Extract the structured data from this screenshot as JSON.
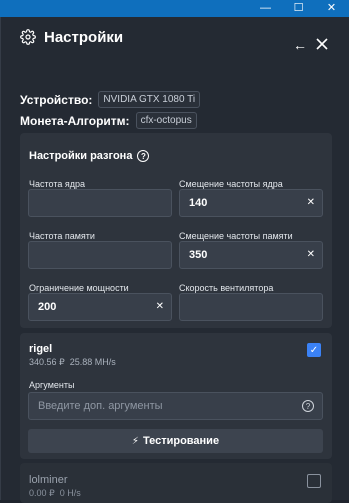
{
  "window": {
    "minimize_glyph": "—",
    "maximize_glyph": "☐",
    "close_glyph": "✕"
  },
  "header": {
    "title": "Настройки",
    "back_glyph": "←",
    "icon": "gear-icon"
  },
  "device": {
    "label": "Устройство:",
    "value": "NVIDIA GTX 1080 Ti"
  },
  "coin_algo": {
    "label": "Монета-Алгоритм:",
    "value": "cfx-octopus"
  },
  "overclock": {
    "title": "Настройки разгона",
    "help_glyph": "?",
    "fields": {
      "core_clock": {
        "label": "Частота ядра",
        "value": ""
      },
      "core_offset": {
        "label": "Смещение частоты ядра",
        "value": "140"
      },
      "mem_clock": {
        "label": "Частота памяти",
        "value": ""
      },
      "mem_offset": {
        "label": "Смещение частоты памяти",
        "value": "350"
      },
      "power_limit": {
        "label": "Ограничение мощности",
        "value": "200"
      },
      "fan_speed": {
        "label": "Скорость вентилятора",
        "value": ""
      }
    },
    "clear_glyph": "✕"
  },
  "miners": [
    {
      "name": "rigel",
      "price": "340.56 ₽",
      "hashrate": "25.88 MH/s",
      "checked": true,
      "args_label": "Аргументы",
      "args_placeholder": "Введите доп. аргументы",
      "test_label": "Тестирование"
    },
    {
      "name": "lolminer",
      "price": "0.00 ₽",
      "hashrate": "0 H/s",
      "checked": false
    }
  ],
  "colors": {
    "titlebar": "#0f6fbd",
    "background": "#242a33",
    "card": "#2e343d",
    "accent": "#3b82f6"
  }
}
